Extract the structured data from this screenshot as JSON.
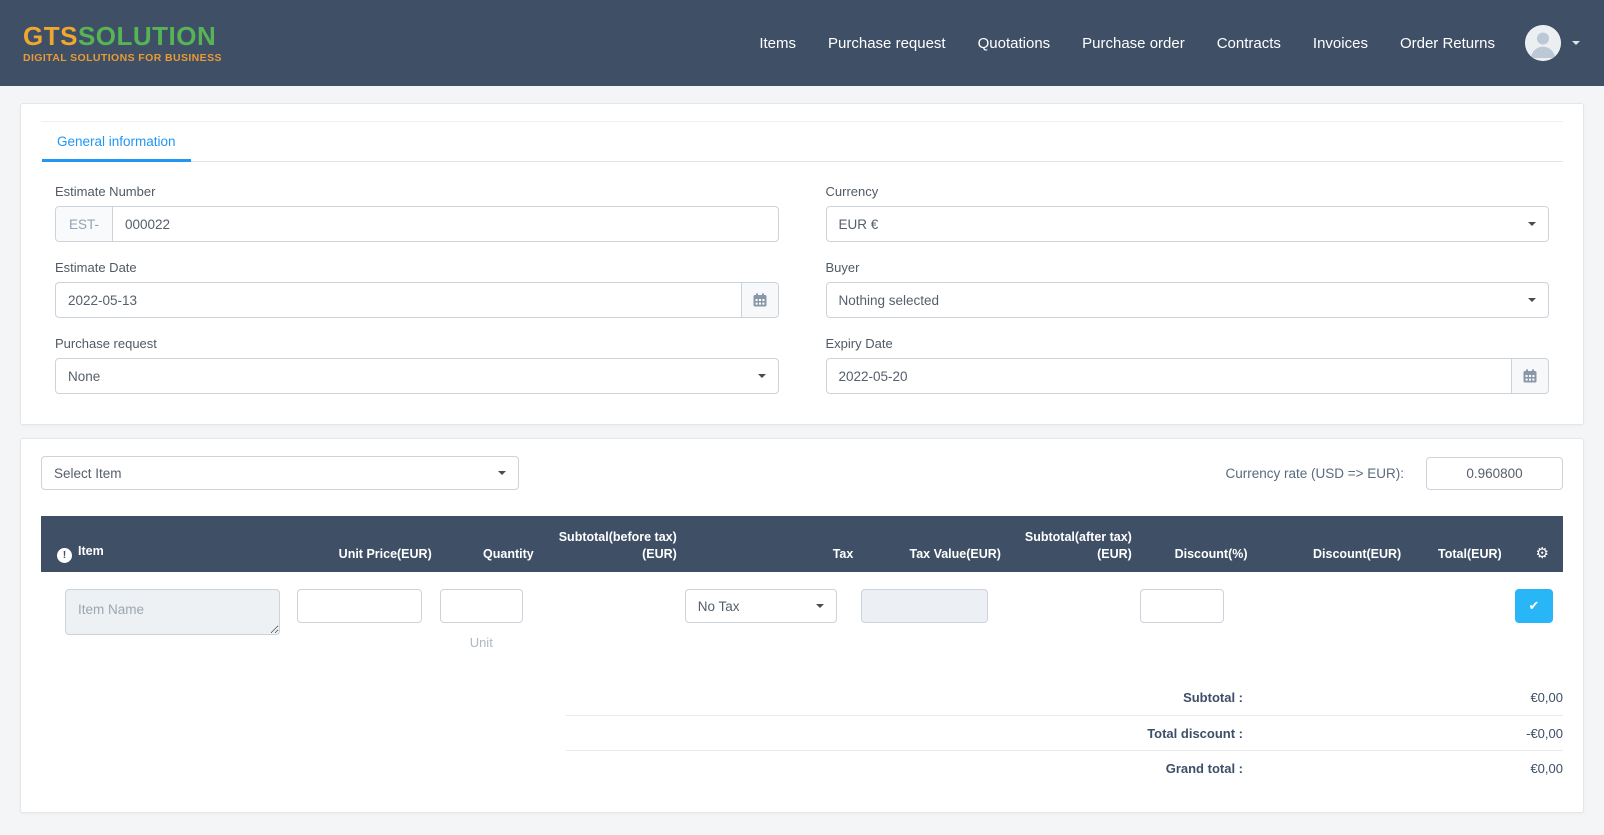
{
  "navbar": {
    "logo": {
      "name": "GTS",
      "name2": "SOLUTION",
      "tagline": "DIGITAL SOLUTIONS FOR BUSINESS"
    },
    "links": [
      {
        "label": "Items"
      },
      {
        "label": "Purchase request"
      },
      {
        "label": "Quotations"
      },
      {
        "label": "Purchase order"
      },
      {
        "label": "Contracts"
      },
      {
        "label": "Invoices"
      },
      {
        "label": "Order Returns"
      }
    ]
  },
  "general": {
    "tab_label": "General information",
    "estimate_number": {
      "label": "Estimate Number",
      "prefix": "EST-",
      "value": "000022"
    },
    "currency": {
      "label": "Currency",
      "selected": "EUR €"
    },
    "estimate_date": {
      "label": "Estimate Date",
      "value": "2022-05-13"
    },
    "buyer": {
      "label": "Buyer",
      "selected": "Nothing selected"
    },
    "purchase_request": {
      "label": "Purchase request",
      "selected": "None"
    },
    "expiry_date": {
      "label": "Expiry Date",
      "value": "2022-05-20"
    }
  },
  "items_section": {
    "select_item": {
      "selected": "Select Item"
    },
    "currency_rate": {
      "label": "Currency rate (USD => EUR):",
      "value": "0.960800"
    },
    "table": {
      "columns": [
        {
          "line1": "Item"
        },
        {
          "line1": "Unit Price(EUR)"
        },
        {
          "line1": "Quantity"
        },
        {
          "line1": "Subtotal(before tax)",
          "line2": "(EUR)"
        },
        {
          "line1": "Tax"
        },
        {
          "line1": "Tax Value(EUR)"
        },
        {
          "line1": "Subtotal(after tax)",
          "line2": "(EUR)"
        },
        {
          "line1": "Discount(%)"
        },
        {
          "line1": "Discount(EUR)"
        },
        {
          "line1": "Total(EUR)"
        }
      ],
      "new_row": {
        "item_placeholder": "Item Name",
        "unit_price_value": "",
        "quantity_value": "",
        "unit_caption": "Unit",
        "tax_selected": "No Tax",
        "tax_value": "",
        "discount_value": ""
      }
    },
    "totals": [
      {
        "label": "Subtotal :",
        "value": "€0,00"
      },
      {
        "label": "Total discount :",
        "value": "-€0,00"
      },
      {
        "label": "Grand total :",
        "value": "€0,00"
      }
    ]
  },
  "icons": {
    "gear": "⚙",
    "check": "✔",
    "item_info": "!"
  },
  "colors": {
    "navbar_bg": "#3e4f66",
    "accent_blue": "#2196f3",
    "confirm_button_blue": "#29b6f6",
    "logo_orange": "#f0a62f",
    "logo_green": "#56b457"
  }
}
